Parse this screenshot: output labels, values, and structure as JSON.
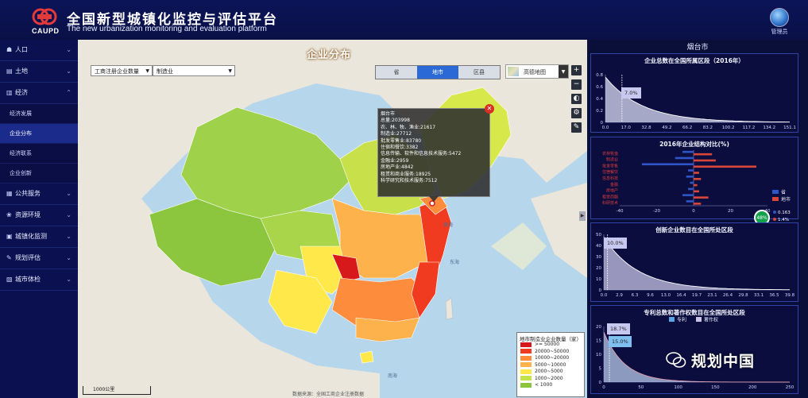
{
  "header": {
    "logo_text": "CAUPD",
    "title": "全国新型城镇化监控与评估平台",
    "subtitle": "The new urbanization monitoring and evaluation platform",
    "admin_label": "管理员"
  },
  "sidebar": {
    "items": [
      {
        "label": "人口",
        "icon": "people-icon",
        "expanded": false
      },
      {
        "label": "土地",
        "icon": "map-icon",
        "expanded": false
      },
      {
        "label": "经济",
        "icon": "chart-icon",
        "expanded": true
      },
      {
        "label": "公共服务",
        "icon": "service-icon",
        "expanded": false
      },
      {
        "label": "资源环境",
        "icon": "leaf-icon",
        "expanded": false
      },
      {
        "label": "城镇化监测",
        "icon": "monitor-icon",
        "expanded": false
      },
      {
        "label": "规划评估",
        "icon": "plan-icon",
        "expanded": false
      },
      {
        "label": "城市体检",
        "icon": "checkup-icon",
        "expanded": false
      }
    ],
    "sub_items": [
      {
        "label": "经济发展",
        "active": false
      },
      {
        "label": "企业分布",
        "active": true
      },
      {
        "label": "经济联系",
        "active": false
      },
      {
        "label": "企业创新",
        "active": false
      }
    ]
  },
  "map": {
    "title": "企业分布",
    "select1": "工商注册企业数量",
    "select2": "制造业",
    "toggle": [
      {
        "label": "省",
        "active": false
      },
      {
        "label": "地市",
        "active": true
      },
      {
        "label": "区县",
        "active": false
      }
    ],
    "base_layer": "高德地图",
    "tools": [
      "+",
      "−",
      "◐",
      "⚙",
      "✎"
    ],
    "sea_labels": [
      "黄海",
      "东海",
      "南海"
    ],
    "tooltip": {
      "lines": [
        "烟台市",
        "总量:203998",
        "农、林、牧、渔业:21617",
        "制造业:27712",
        "批发零售业:83780",
        "住宿和餐饮:3382",
        "信息传输、软件和信息技术服务:5472",
        "金融业:2959",
        "房地产业:4842",
        "租赁和商业服务:18925",
        "科学研究和技术服务:7512"
      ]
    },
    "legend": {
      "title": "地市制造业企业数量（家）",
      "items": [
        {
          "label": ">= 50000",
          "color": "#d7191c"
        },
        {
          "label": "20000~50000",
          "color": "#f03b20"
        },
        {
          "label": "10000~20000",
          "color": "#fd8d3c"
        },
        {
          "label": "5000~10000",
          "color": "#feb24c"
        },
        {
          "label": "2000~5000",
          "color": "#ffe94a"
        },
        {
          "label": "1000~2000",
          "color": "#c2e34a"
        },
        {
          "label": "< 1000",
          "color": "#8cc63f"
        }
      ]
    },
    "scale_label": "1000公里",
    "credit": "数据来源：全国工商企业注册数据"
  },
  "right_panel": {
    "city": "烟台市",
    "cards": [
      {
        "title": "企业总数在全国所属区段（2016年）",
        "x_ticks": [
          "0.0",
          "17.0",
          "32.8",
          "49.2",
          "66.2",
          "83.2",
          "100.2",
          "117.2",
          "134.2",
          "151.1"
        ],
        "y_ticks": [
          "0.8",
          "0.6",
          "0.4",
          "0.2",
          "0"
        ],
        "marker_label": "7.0%"
      },
      {
        "title": "2016年企业结构对比(%)",
        "categories": [
          "农林牧渔",
          "制造业",
          "批发零售",
          "住宿餐饮",
          "信息科技",
          "金融",
          "房地产",
          "租赁商服",
          "科研技术"
        ],
        "x_ticks": [
          "-40",
          "-20",
          "0",
          "20",
          "40"
        ],
        "series": [
          {
            "name": "省",
            "color": "#2f56c9",
            "values": [
              -6,
              -10,
              -28,
              -3,
              -4,
              -2,
              -3,
              -6,
              -4
            ]
          },
          {
            "name": "地市",
            "color": "#d9473a",
            "values": [
              10,
              12,
              34,
              3,
              4,
              2,
              3,
              8,
              4
            ]
          }
        ],
        "badge": "48%",
        "stats": [
          "0.163",
          "1.4%"
        ]
      },
      {
        "title": "创新企业数目在全国所处区段",
        "x_ticks": [
          "0.0",
          "2.9",
          "6.3",
          "9.6",
          "13.0",
          "16.4",
          "19.7",
          "23.1",
          "26.4",
          "29.8",
          "33.1",
          "36.5",
          "39.8"
        ],
        "y_ticks": [
          "50",
          "40",
          "30",
          "20",
          "10",
          "0"
        ],
        "marker_label": "10.0%"
      },
      {
        "title": "专利总数和著作权数目在全国所处区段",
        "legend": [
          "专利",
          "著作权"
        ],
        "x_ticks": [
          "0",
          "50",
          "100",
          "150",
          "200",
          "250"
        ],
        "y_ticks": [
          "20",
          "15",
          "10",
          "5",
          "0"
        ],
        "marker_labels": [
          "18.7%",
          "15.0%"
        ]
      }
    ]
  },
  "watermark": "规划中国"
}
